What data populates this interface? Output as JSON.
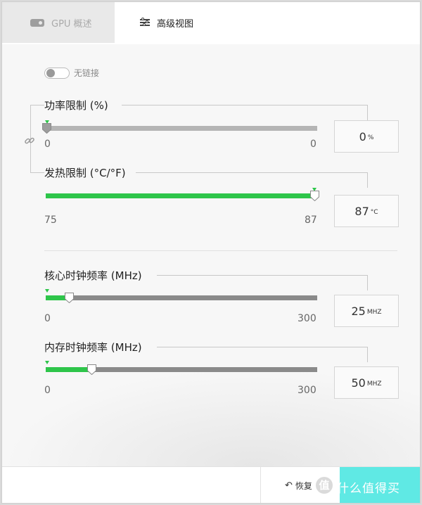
{
  "tabs": [
    {
      "label": "GPU 概述",
      "icon": "gpu-card-icon",
      "active": false
    },
    {
      "label": "高级视图",
      "icon": "sliders-icon",
      "active": true
    }
  ],
  "link_toggle": {
    "label": "无链接",
    "on": false
  },
  "sliders": [
    {
      "label": "功率限制 (%)",
      "min": "0",
      "max": "0",
      "value": "0",
      "unit": "%",
      "fraction": 0.0,
      "style": "light"
    },
    {
      "label": "发热限制 (°C/°F)",
      "min": "75",
      "max": "87",
      "value": "87",
      "unit": "°C",
      "fraction": 1.0,
      "style": "light"
    },
    {
      "label": "核心时钟频率 (MHz)",
      "min": "0",
      "max": "300",
      "value": "25",
      "unit": "MHZ",
      "fraction": 0.0833,
      "style": "dark"
    },
    {
      "label": "内存时钟频率 (MHz)",
      "min": "0",
      "max": "300",
      "value": "50",
      "unit": "MHZ",
      "fraction": 0.1667,
      "style": "dark"
    }
  ],
  "footer": {
    "reset_label": "恢复",
    "watermark_badge": "值",
    "watermark_text": "什么值得买"
  },
  "colors": {
    "accent_green": "#2ec54a",
    "apply_button": "#5fe9e4"
  }
}
